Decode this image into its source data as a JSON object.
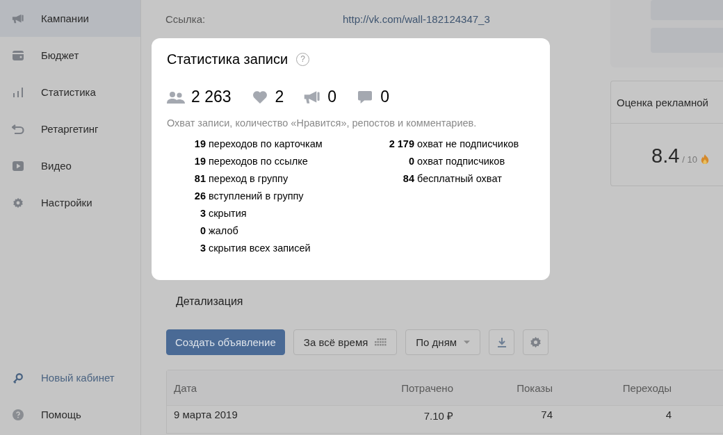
{
  "sidebar": {
    "items": [
      {
        "kind": "megaphone",
        "label": "Кампании",
        "selected": true
      },
      {
        "kind": "wallet",
        "label": "Бюджет",
        "selected": false
      },
      {
        "kind": "bars",
        "label": "Статистика",
        "selected": false
      },
      {
        "kind": "return",
        "label": "Ретаргетинг",
        "selected": false
      },
      {
        "kind": "play",
        "label": "Видео",
        "selected": false
      },
      {
        "kind": "gear",
        "label": "Настройки",
        "selected": false
      }
    ],
    "bottom_items": [
      {
        "kind": "link",
        "label": "Новый кабинет"
      },
      {
        "kind": "help",
        "label": "Помощь"
      }
    ]
  },
  "link_row": {
    "label": "Ссылка:",
    "value": "http://vk.com/wall-182124347_3"
  },
  "score_card": {
    "title": "Оценка рекламной",
    "score": "8.4",
    "scale": "/ 10"
  },
  "popup": {
    "title": "Статистика записи",
    "help": "?",
    "counters": [
      {
        "kind": "people",
        "value": "2 263"
      },
      {
        "kind": "heart",
        "value": "2"
      },
      {
        "kind": "megaphone",
        "value": "0"
      },
      {
        "kind": "comment",
        "value": "0"
      }
    ],
    "caption": "Охват записи, количество «Нравится», репостов и комментариев.",
    "left_stats": [
      {
        "number": "19",
        "label": "переходов по карточкам"
      },
      {
        "number": "19",
        "label": "переходов по ссылке"
      },
      {
        "number": "81",
        "label": "переход в группу"
      },
      {
        "number": "26",
        "label": "вступлений в группу"
      },
      {
        "number": "3",
        "label": "скрытия"
      },
      {
        "number": "0",
        "label": "жалоб"
      },
      {
        "number": "3",
        "label": "скрытия всех записей"
      }
    ],
    "right_stats": [
      {
        "number": "2 179",
        "label": "охват не подписчиков"
      },
      {
        "number": "0",
        "label": "охват подписчиков"
      },
      {
        "number": "84",
        "label": "бесплатный охват"
      }
    ]
  },
  "details": {
    "title": "Детализация",
    "create_button": "Создать объявление",
    "period_button": "За всё время",
    "grouping_button": "По дням"
  },
  "table": {
    "columns": [
      "Дата",
      "Потрачено",
      "Показы",
      "Переходы"
    ],
    "rows": [
      [
        "9 марта 2019",
        "7.10 ₽",
        "74",
        "4"
      ]
    ]
  }
}
